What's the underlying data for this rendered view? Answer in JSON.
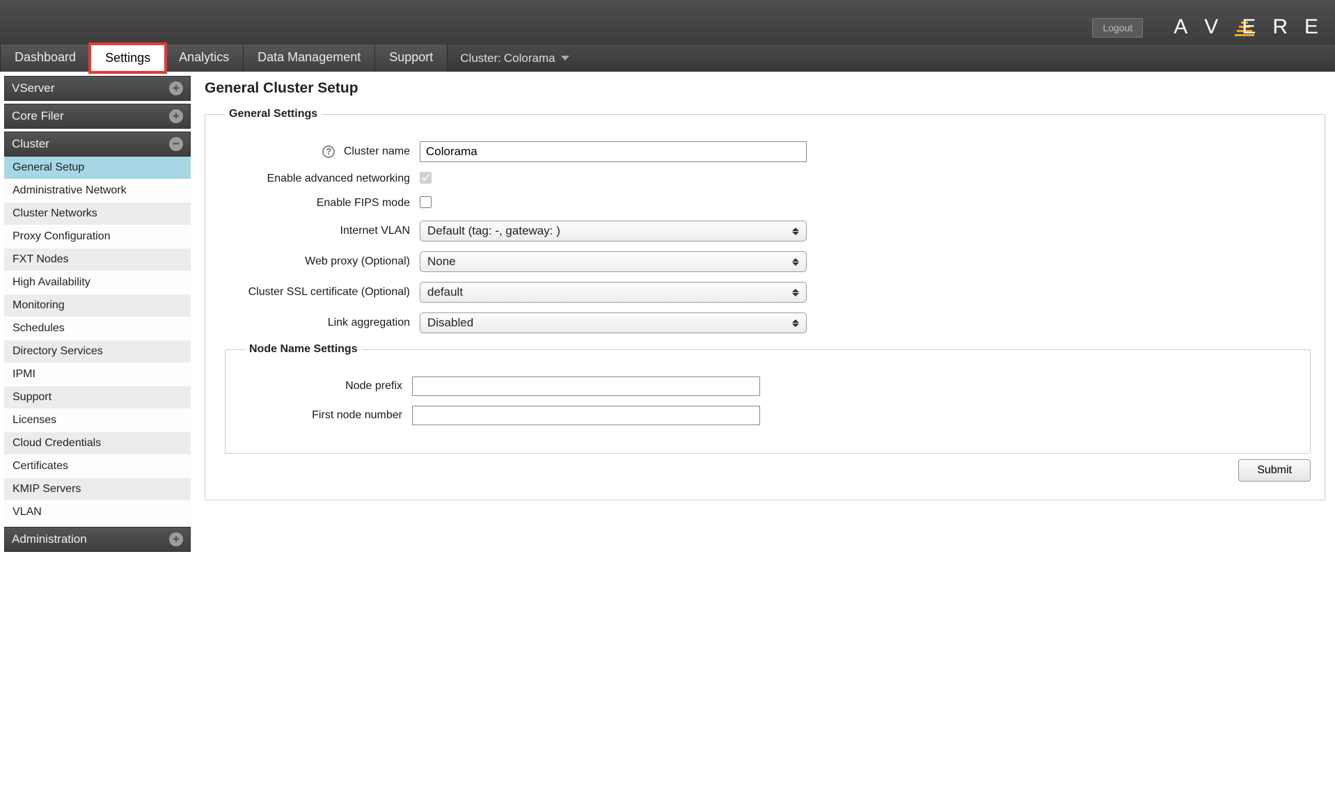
{
  "header": {
    "logout": "Logout",
    "logo_letters": [
      "A",
      "V",
      "E",
      "R",
      "E"
    ],
    "cluster_prefix": "Cluster:",
    "cluster_name": "Colorama"
  },
  "tabs": {
    "dashboard": "Dashboard",
    "settings": "Settings",
    "analytics": "Analytics",
    "data_mgmt": "Data Management",
    "support": "Support"
  },
  "sidebar": {
    "sections": {
      "vserver": "VServer",
      "core_filer": "Core Filer",
      "cluster": "Cluster",
      "administration": "Administration"
    },
    "cluster_items": [
      "General Setup",
      "Administrative Network",
      "Cluster Networks",
      "Proxy Configuration",
      "FXT Nodes",
      "High Availability",
      "Monitoring",
      "Schedules",
      "Directory Services",
      "IPMI",
      "Support",
      "Licenses",
      "Cloud Credentials",
      "Certificates",
      "KMIP Servers",
      "VLAN"
    ]
  },
  "page": {
    "title": "General Cluster Setup",
    "legend_general": "General Settings",
    "legend_node": "Node Name Settings",
    "labels": {
      "cluster_name": "Cluster name",
      "enable_adv_net": "Enable advanced networking",
      "enable_fips": "Enable FIPS mode",
      "internet_vlan": "Internet VLAN",
      "web_proxy": "Web proxy (Optional)",
      "ssl_cert": "Cluster SSL certificate (Optional)",
      "link_agg": "Link aggregation",
      "node_prefix": "Node prefix",
      "first_node_num": "First node number"
    },
    "values": {
      "cluster_name": "Colorama",
      "enable_adv_net": true,
      "enable_fips": false,
      "internet_vlan": "Default (tag: -, gateway:             )",
      "web_proxy": "None",
      "ssl_cert": "default",
      "link_agg": "Disabled",
      "node_prefix": "",
      "first_node_num": ""
    },
    "submit": "Submit"
  }
}
